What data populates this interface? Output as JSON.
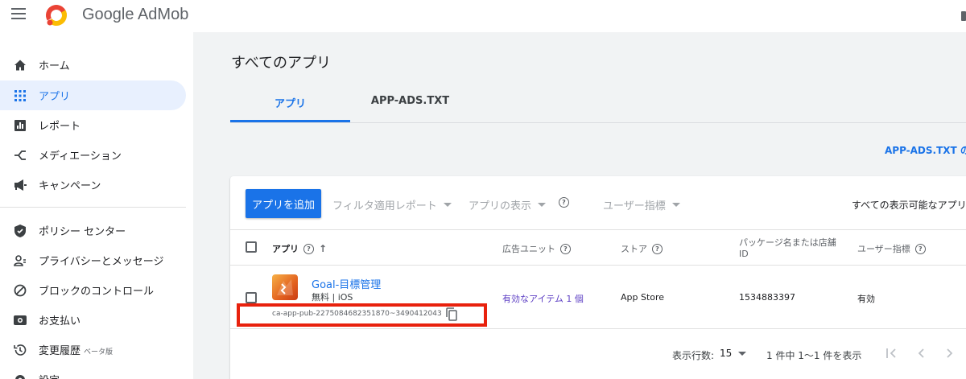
{
  "app": {
    "brand": "Google AdMob"
  },
  "sidebar": {
    "items": [
      {
        "label": "ホーム",
        "icon": "home-icon"
      },
      {
        "label": "アプリ",
        "icon": "apps-grid-icon",
        "active": true
      },
      {
        "label": "レポート",
        "icon": "report-icon"
      },
      {
        "label": "メディエーション",
        "icon": "mediation-icon"
      },
      {
        "label": "キャンペーン",
        "icon": "megaphone-icon"
      },
      {
        "label": "ポリシー センター",
        "icon": "shield-icon"
      },
      {
        "label": "プライバシーとメッセージ",
        "icon": "privacy-icon"
      },
      {
        "label": "ブロックのコントロール",
        "icon": "block-icon"
      },
      {
        "label": "お支払い",
        "icon": "payments-icon"
      },
      {
        "label": "変更履歴",
        "badge": "ベータ版",
        "icon": "history-icon"
      },
      {
        "label": "設定",
        "icon": "settings-icon"
      }
    ]
  },
  "main": {
    "title": "すべてのアプリ",
    "tabs": [
      {
        "label": "アプリ",
        "active": true
      },
      {
        "label": "APP-ADS.TXT"
      }
    ],
    "appads_link": "APP-ADS.TXT の"
  },
  "toolbar": {
    "add_app": "アプリを追加",
    "filter_report": "フィルタ適用レポート",
    "app_view": "アプリの表示",
    "user_metrics": "ユーザー指標",
    "visible_select": "すべての表示可能なアプリ"
  },
  "table": {
    "headers": {
      "app": "アプリ",
      "ad_units": "広告ユニット",
      "store": "ストア",
      "package": "パッケージ名または店舗",
      "package_id": "ID",
      "user_metrics": "ユーザー指標"
    },
    "rows": [
      {
        "name": "Goal-目標管理",
        "meta": "無料 | iOS",
        "app_id": "ca-app-pub-2275084682351870~3490412043",
        "ad_units": "有効なアイテム 1 個",
        "store": "App Store",
        "package": "1534883397",
        "user_metrics": "有効"
      }
    ]
  },
  "pagination": {
    "rows_label": "表示行数:",
    "rows_value": "15",
    "range": "1 件中 1〜1 件を表示"
  },
  "colors": {
    "accent": "#1a73e8",
    "highlight_box": "#e8210d",
    "ad_unit_link": "#5d3fc4"
  }
}
